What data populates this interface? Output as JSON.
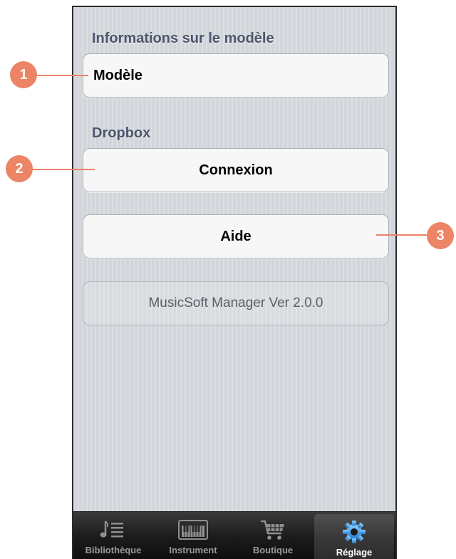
{
  "settings": {
    "model_section": "Informations sur le modèle",
    "model_row": "Modèle",
    "dropbox_section": "Dropbox",
    "connect_button": "Connexion",
    "help_button": "Aide",
    "version": "MusicSoft Manager Ver 2.0.0"
  },
  "tabbar": {
    "tabs": [
      {
        "label": "Bibliothèque",
        "icon": "library-icon"
      },
      {
        "label": "Instrument",
        "icon": "piano-icon"
      },
      {
        "label": "Boutique",
        "icon": "cart-icon"
      },
      {
        "label": "Réglage",
        "icon": "gear-icon"
      }
    ],
    "active": "Réglage"
  },
  "callouts": [
    "1",
    "2",
    "3"
  ],
  "colors": {
    "callout": "#ec8466",
    "section_header": "#4c566c",
    "active_icon": "#3f9ae3"
  }
}
